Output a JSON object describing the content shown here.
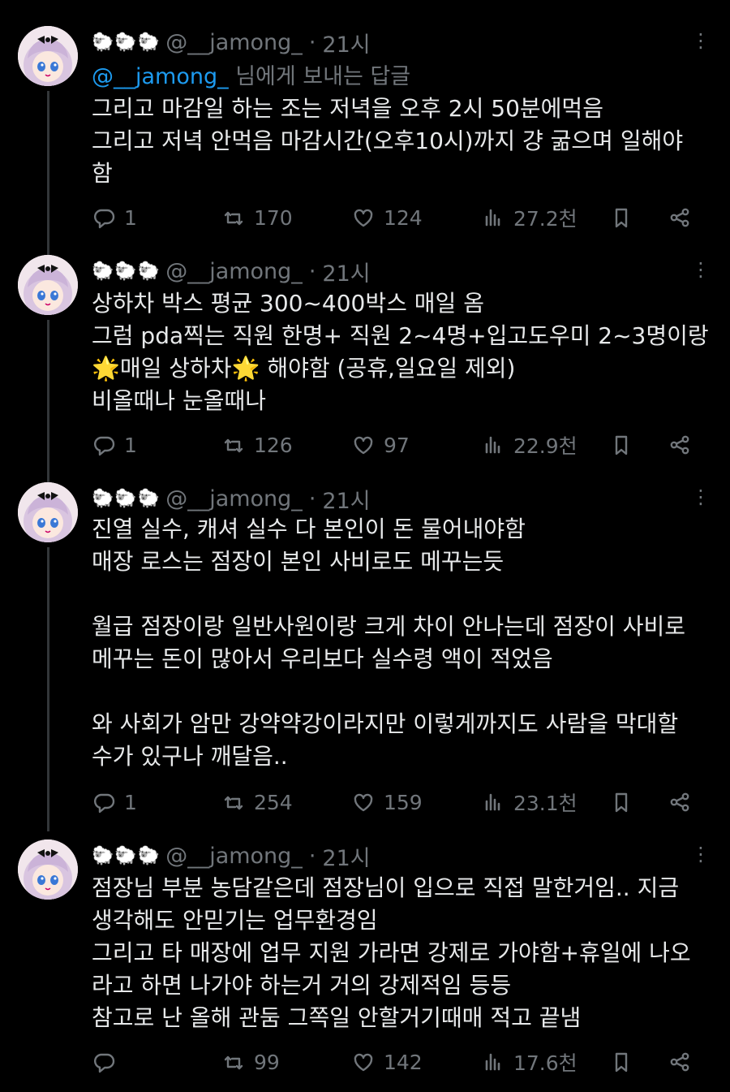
{
  "tweets": [
    {
      "sheep_icons": "🐑🐑🐑",
      "handle": "@__jamong_",
      "dot": "·",
      "time": "21시",
      "more": "⋮",
      "replying_to": "@__jamong_",
      "replying_suffix": " 님에게 보내는 답글",
      "lines": [
        "그리고 마감일 하는 조는 저녁을 오후 2시 50분에먹음",
        "그리고 저녁 안먹음 마감시간(오후10시)까지 걍 굶으며 일해야",
        "함"
      ],
      "replies": "1",
      "retweets": "170",
      "likes": "124",
      "views": "27.2천"
    },
    {
      "sheep_icons": "🐑🐑🐑",
      "handle": "@__jamong_",
      "dot": "·",
      "time": "21시",
      "more": "⋮",
      "lines": [
        "상하차 박스 평균 300~400박스 매일 옴",
        "그럼 pda찍는 직원 한명+ 직원 2~4명+입고도우미 2~3명이랑",
        "🌟매일 상하차🌟 해야함 (공휴,일요일 제외)",
        "비올때나 눈올때나"
      ],
      "replies": "1",
      "retweets": "126",
      "likes": "97",
      "views": "22.9천"
    },
    {
      "sheep_icons": "🐑🐑🐑",
      "handle": "@__jamong_",
      "dot": "·",
      "time": "21시",
      "more": "⋮",
      "lines": [
        "진열 실수, 캐셔 실수 다 본인이 돈 물어내야함",
        "매장 로스는 점장이 본인 사비로도 메꾸는듯",
        "",
        "월급 점장이랑 일반사원이랑 크게 차이 안나는데 점장이 사비로",
        "메꾸는 돈이 많아서 우리보다 실수령 액이 적었음",
        "",
        "와 사회가 암만 강약약강이라지만 이렇게까지도 사람을 막대할",
        "수가 있구나 깨달음.."
      ],
      "replies": "1",
      "retweets": "254",
      "likes": "159",
      "views": "23.1천"
    },
    {
      "sheep_icons": "🐑🐑🐑",
      "handle": "@__jamong_",
      "dot": "·",
      "time": "21시",
      "more": "⋮",
      "lines": [
        "점장님 부분 농담같은데 점장님이 입으로 직접 말한거임.. 지금",
        "생각해도 안믿기는 업무환경임",
        "그리고 타 매장에 업무 지원 가라면 강제로 가야함+휴일에 나오",
        "라고 하면 나가야 하는거 거의 강제적임 등등",
        "참고로 난 올해 관둠 그쪽일 안할거기때매 적고 끝냄"
      ],
      "replies": "",
      "retweets": "99",
      "likes": "142",
      "views": "17.6천"
    }
  ]
}
